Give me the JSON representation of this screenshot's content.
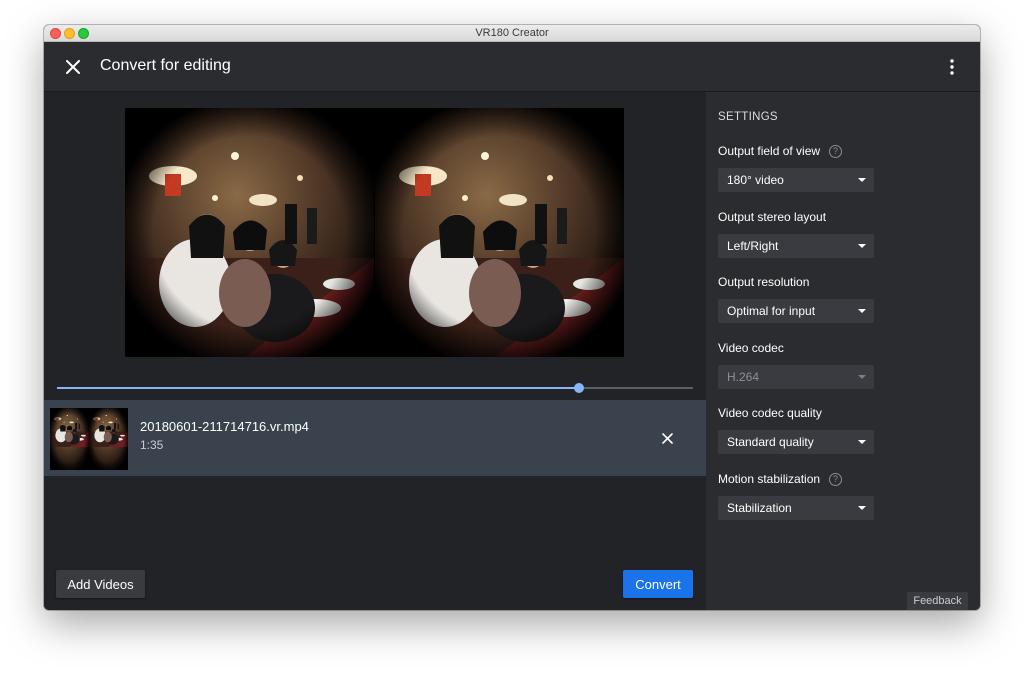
{
  "window": {
    "title": "VR180 Creator"
  },
  "header": {
    "title": "Convert for editing",
    "close_icon": "close-icon",
    "more_icon": "more-vert-icon"
  },
  "preview": {
    "scrub_progress": 0.82
  },
  "video_list": [
    {
      "file_name": "20180601-211714716.vr.mp4",
      "duration": "1:35"
    }
  ],
  "actions": {
    "add_videos_label": "Add Videos",
    "convert_label": "Convert"
  },
  "settings": {
    "title": "SETTINGS",
    "field_of_view": {
      "label": "Output field of view",
      "value": "180° video"
    },
    "stereo_layout": {
      "label": "Output stereo layout",
      "value": "Left/Right"
    },
    "resolution": {
      "label": "Output resolution",
      "value": "Optimal for input"
    },
    "codec": {
      "label": "Video codec",
      "value": "H.264"
    },
    "codec_quality": {
      "label": "Video codec quality",
      "value": "Standard quality"
    },
    "stabilization": {
      "label": "Motion stabilization",
      "value": "Stabilization"
    },
    "help_symbol": "?"
  },
  "feedback_label": "Feedback",
  "colors": {
    "accent": "#1a73e8",
    "scrub": "#8ab4f8",
    "panel": "#2b2c30",
    "background": "#222327",
    "selected_row": "#3a424e"
  }
}
